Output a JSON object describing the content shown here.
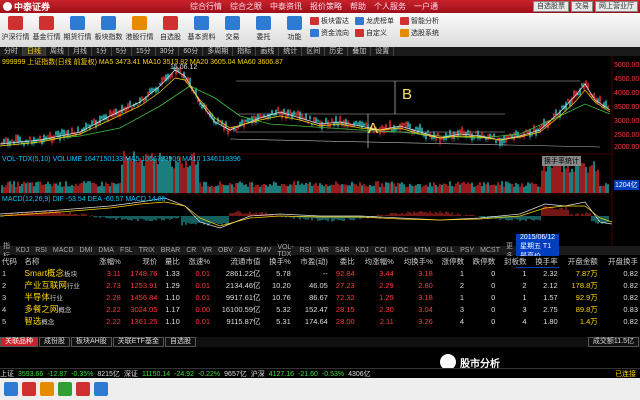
{
  "app": {
    "name": "中泰证券"
  },
  "menu": [
    "综合行情",
    "综合之眼",
    "中泰资讯",
    "报价策略",
    "帮助",
    "个人服务",
    "一户通"
  ],
  "top_buttons": [
    "自选股票",
    "交易",
    "网上营业厅"
  ],
  "toolbar": [
    {
      "label": "沪深行情",
      "color": "#d03030",
      "icon": "chart-icon"
    },
    {
      "label": "基金行情",
      "color": "#d03030",
      "icon": "fund-icon"
    },
    {
      "label": "期货行情",
      "color": "#2e7bd3",
      "icon": "futures-icon"
    },
    {
      "label": "板块指数",
      "color": "#2e7bd3",
      "icon": "sector-icon"
    },
    {
      "label": "港股行情",
      "color": "#e68a00",
      "icon": "hk-icon"
    },
    {
      "label": "自选股",
      "color": "#d03030",
      "icon": "star-icon"
    },
    {
      "label": "基本资料",
      "color": "#2e7bd3",
      "icon": "info-icon"
    },
    {
      "label": "交易",
      "color": "#2e7bd3",
      "icon": "trade-icon"
    },
    {
      "label": "委托",
      "color": "#2e7bd3",
      "icon": "order-icon"
    },
    {
      "label": "功能",
      "color": "#2e7bd3",
      "icon": "function-icon"
    }
  ],
  "toolbar_small": [
    [
      {
        "label": "板块雷达",
        "color": "#d03030"
      },
      {
        "label": "资金流向",
        "color": "#2e7bd3"
      }
    ],
    [
      {
        "label": "龙虎榜单",
        "color": "#2e7bd3"
      },
      {
        "label": "自定义",
        "color": "#d03030"
      }
    ],
    [
      {
        "label": "智能分析",
        "color": "#d03030"
      },
      {
        "label": "选股系统",
        "color": "#e68a00"
      }
    ]
  ],
  "tabs": [
    "分时",
    "日线",
    "周线",
    "月线",
    "1分",
    "5分",
    "15分",
    "30分",
    "60分",
    "多周期",
    "指标",
    "画线",
    "统计",
    "区间",
    "历史",
    "叠加",
    "设置"
  ],
  "chart": {
    "header": "999999 上证指数(日线 前复权) MA5 3473.41 MA10 3513.82 MA20 3605.04 MA60 3606.87",
    "peak_label": "5178.19",
    "date_label": "15.06.12",
    "annot_a": "A",
    "annot_b": "B",
    "vol_header": "VOL-TDX(5,10) VOLUME 1647150133 MA5 1066723906 MA10 1346118396",
    "macd_header": "MACD(12,26,9) DIF -53.54 DEA -60.57 MACD 14.06",
    "y_labels": [
      "5000.00",
      "4500.00",
      "4000.00",
      "3500.00",
      "3000.00",
      "2500.00",
      "2000.00"
    ],
    "vol_tag": "1204亿",
    "tooltip": "换手率统计"
  },
  "indicator_tabs": [
    "指标",
    "KDJ",
    "RSI",
    "MACD",
    "DMI",
    "DMA",
    "FSL",
    "TRIX",
    "BRAR",
    "CR",
    "VR",
    "OBV",
    "ASI",
    "EMV",
    "VOL-TDX",
    "RSI",
    "WR",
    "SAR",
    "KDJ",
    "CCI",
    "ROC",
    "MTM",
    "BOLL",
    "PSY",
    "MCST",
    "更多"
  ],
  "indicator_tag": "2015/06/12 星期五 T1 最高价 5178.19",
  "table": {
    "headers": [
      "代码",
      "名称",
      "涨幅%",
      "现价",
      "量比",
      "涨速%",
      "流通市值",
      "换手%",
      "市盈(动)",
      "委比",
      "均涨幅%",
      "均换手%",
      "涨停数",
      "跌停数",
      "封板数",
      "换手率",
      "开盘金额",
      "开盘换手"
    ],
    "rows": [
      {
        "idx": "1",
        "name": "Smart概念",
        "tag": "板块",
        "vals": [
          "3.11",
          "1748.76",
          "1.33",
          "0.01",
          "2861.22亿",
          "5.78",
          "--",
          "92.84",
          "3.44",
          "3.18",
          "1",
          "0",
          "1",
          "2.32",
          "7.87万",
          "0.82"
        ]
      },
      {
        "idx": "2",
        "name": "产业互联网",
        "tag": "行业",
        "vals": [
          "2.73",
          "1253.91",
          "1.29",
          "0.01",
          "2134.46亿",
          "10.20",
          "46.05",
          "27.23",
          "2.29",
          "2.80",
          "2",
          "0",
          "2",
          "2.12",
          "178.8万",
          "0.82"
        ]
      },
      {
        "idx": "3",
        "name": "半导体",
        "tag": "行业",
        "vals": [
          "2.28",
          "1456.84",
          "1.10",
          "0.01",
          "9917.61亿",
          "10.76",
          "86.67",
          "72.32",
          "1.29",
          "3.18",
          "1",
          "0",
          "1",
          "1.57",
          "92.9万",
          "0.82"
        ]
      },
      {
        "idx": "4",
        "name": "多餐之网",
        "tag": "概念",
        "vals": [
          "2.22",
          "3024.05",
          "1.17",
          "0.00",
          "16100.59亿",
          "5.32",
          "152.47",
          "28.15",
          "2.30",
          "3.04",
          "3",
          "0",
          "3",
          "2.75",
          "89.8万",
          "0.83"
        ]
      },
      {
        "idx": "5",
        "name": "智选",
        "tag": "概念",
        "vals": [
          "2.22",
          "1361.25",
          "1.10",
          "0.01",
          "9115.87亿",
          "5.31",
          "174.64",
          "28.00",
          "2.11",
          "3.26",
          "4",
          "0",
          "4",
          "1.80",
          "1.4万",
          "0.82"
        ]
      }
    ]
  },
  "bottom_tabs": [
    "关联品种",
    "成份股",
    "板块AH股",
    "关联ETF基金",
    "自选股"
  ],
  "bottom_right": "成交额11.5亿",
  "status": {
    "sh_label": "上证",
    "sh_val": "3593.66",
    "sh_chg": "-12.87",
    "sh_pct": "-0.35%",
    "sh_amt": "8215亿",
    "sz_label": "深证",
    "sz_val": "11150.14",
    "sz_chg": "-24.92",
    "sz_pct": "-0.22%",
    "sz_amt": "9657亿",
    "cy_label": "沪深",
    "cy_val": "4127.16",
    "cy_chg": "-21.60",
    "cy_pct": "-0.53%",
    "cy_amt": "4306亿",
    "right": "已连接"
  },
  "watermark": "股市分析",
  "taskbar_colors": [
    "#2e7bd3",
    "#d03030",
    "#e68a00",
    "#30a030",
    "#d03030",
    "#2e7bd3"
  ]
}
